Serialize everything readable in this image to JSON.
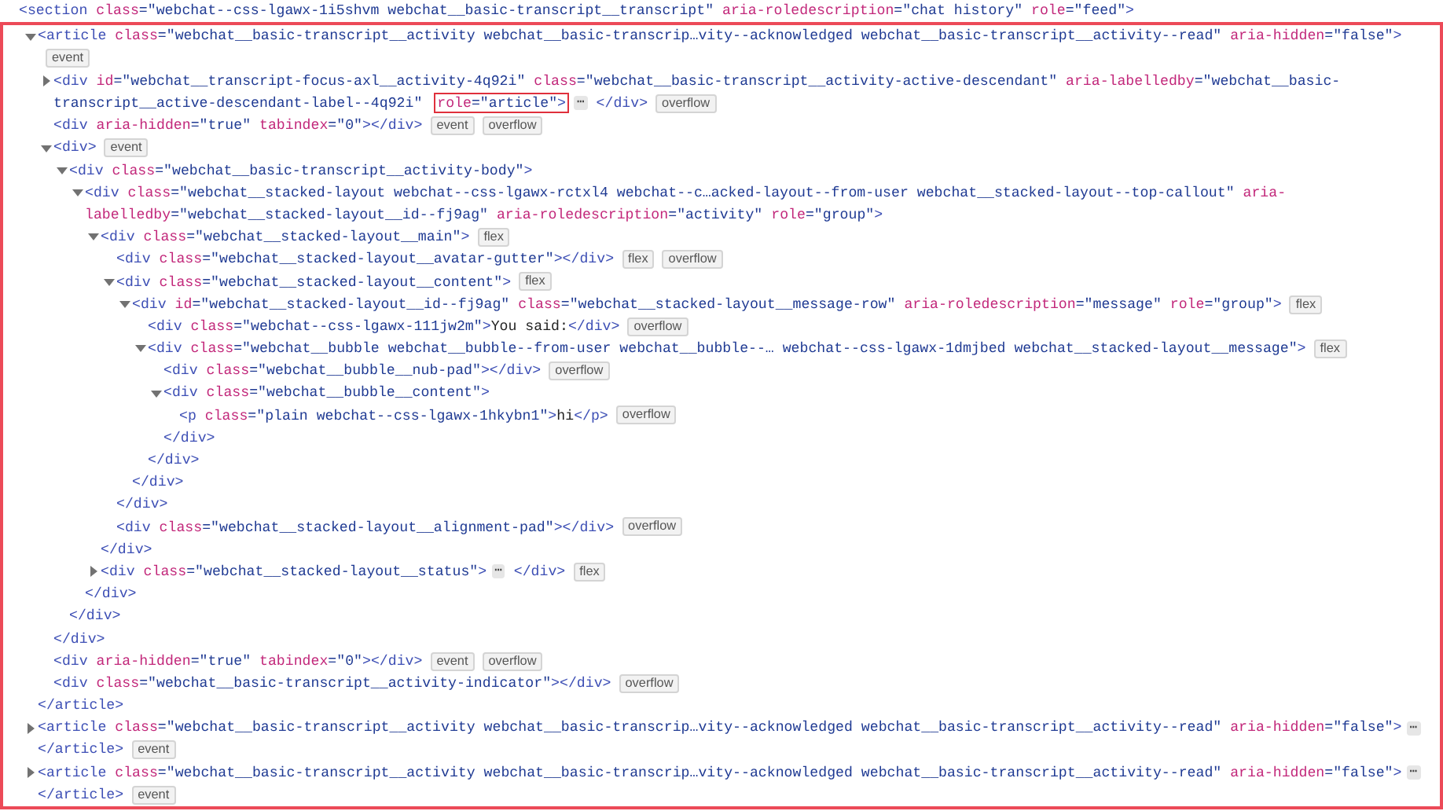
{
  "dom_tree": [
    {
      "lines": [
        [
          {
            "kind": "tag",
            "text": "<section "
          },
          {
            "kind": "attr",
            "text": "class"
          },
          {
            "kind": "val",
            "text": "=\"webchat--css-lgawx-1i5shvm webchat__basic-transcript__transcript\" "
          },
          {
            "kind": "attr",
            "text": "aria-roledescription"
          },
          {
            "kind": "val",
            "text": "=\"chat history\" "
          },
          {
            "kind": "attr",
            "text": "role"
          },
          {
            "kind": "val",
            "text": "=\"feed\""
          },
          {
            "kind": "tag",
            "text": ">"
          }
        ]
      ],
      "children": [
        {
          "expanded": true,
          "lines": [
            [
              {
                "kind": "tag",
                "text": "<article "
              },
              {
                "kind": "attr",
                "text": "class"
              },
              {
                "kind": "val",
                "text": "=\"webchat__basic-transcript__activity webchat__basic-transcrip…vity--acknowledged webchat__basic-transcript__activity--read\" "
              },
              {
                "kind": "attr",
                "text": "aria-hidden"
              },
              {
                "kind": "val",
                "text": "=\"false\""
              },
              {
                "kind": "tag",
                "text": ">"
              }
            ],
            [
              {
                "kind": "badge",
                "text": "event"
              }
            ]
          ],
          "close": [
            [
              {
                "kind": "tag",
                "text": "</article>"
              }
            ]
          ],
          "children": [
            {
              "expanded": false,
              "lines": [
                [
                  {
                    "kind": "tag",
                    "text": "<div "
                  },
                  {
                    "kind": "attr",
                    "text": "id"
                  },
                  {
                    "kind": "val",
                    "text": "=\"webchat__transcript-focus-axl__activity-4q92i\" "
                  },
                  {
                    "kind": "attr",
                    "text": "class"
                  },
                  {
                    "kind": "val",
                    "text": "=\"webchat__basic-transcript__activity-active-descendant\" "
                  },
                  {
                    "kind": "attr",
                    "text": "aria-labelledby"
                  },
                  {
                    "kind": "val",
                    "text": "=\"webchat__basic-"
                  }
                ],
                [
                  {
                    "kind": "val",
                    "text": "transcript__active-descendant-label--4q92i\" "
                  },
                  {
                    "kind": "highlight",
                    "parts": [
                      {
                        "kind": "attr",
                        "text": "role"
                      },
                      {
                        "kind": "val",
                        "text": "=\"article\""
                      },
                      {
                        "kind": "tag",
                        "text": ">"
                      }
                    ]
                  },
                  {
                    "kind": "more",
                    "text": "⋯"
                  },
                  {
                    "kind": "tag",
                    "text": " </div>"
                  },
                  {
                    "kind": "badge",
                    "text": "overflow"
                  }
                ]
              ]
            },
            {
              "lines": [
                [
                  {
                    "kind": "tag",
                    "text": "<div "
                  },
                  {
                    "kind": "attr",
                    "text": "aria-hidden"
                  },
                  {
                    "kind": "val",
                    "text": "=\"true\" "
                  },
                  {
                    "kind": "attr",
                    "text": "tabindex"
                  },
                  {
                    "kind": "val",
                    "text": "=\"0\""
                  },
                  {
                    "kind": "tag",
                    "text": "></div>"
                  },
                  {
                    "kind": "badge",
                    "text": "event"
                  },
                  {
                    "kind": "badge",
                    "text": "overflow"
                  }
                ]
              ]
            },
            {
              "expanded": true,
              "lines": [
                [
                  {
                    "kind": "tag",
                    "text": "<div>"
                  },
                  {
                    "kind": "badge",
                    "text": "event"
                  }
                ]
              ],
              "close": [
                [
                  {
                    "kind": "tag",
                    "text": "</div>"
                  }
                ]
              ],
              "children": [
                {
                  "expanded": true,
                  "lines": [
                    [
                      {
                        "kind": "tag",
                        "text": "<div "
                      },
                      {
                        "kind": "attr",
                        "text": "class"
                      },
                      {
                        "kind": "val",
                        "text": "=\"webchat__basic-transcript__activity-body\""
                      },
                      {
                        "kind": "tag",
                        "text": ">"
                      }
                    ]
                  ],
                  "close": [
                    [
                      {
                        "kind": "tag",
                        "text": "</div>"
                      }
                    ]
                  ],
                  "children": [
                    {
                      "expanded": true,
                      "lines": [
                        [
                          {
                            "kind": "tag",
                            "text": "<div "
                          },
                          {
                            "kind": "attr",
                            "text": "class"
                          },
                          {
                            "kind": "val",
                            "text": "=\"webchat__stacked-layout webchat--css-lgawx-rctxl4 webchat--c…acked-layout--from-user webchat__stacked-layout--top-callout\" "
                          },
                          {
                            "kind": "attr",
                            "text": "aria-"
                          }
                        ],
                        [
                          {
                            "kind": "attr",
                            "text": "labelledby"
                          },
                          {
                            "kind": "val",
                            "text": "=\"webchat__stacked-layout__id--fj9ag\" "
                          },
                          {
                            "kind": "attr",
                            "text": "aria-roledescription"
                          },
                          {
                            "kind": "val",
                            "text": "=\"activity\" "
                          },
                          {
                            "kind": "attr",
                            "text": "role"
                          },
                          {
                            "kind": "val",
                            "text": "=\"group\""
                          },
                          {
                            "kind": "tag",
                            "text": ">"
                          }
                        ]
                      ],
                      "close": [
                        [
                          {
                            "kind": "tag",
                            "text": "</div>"
                          }
                        ]
                      ],
                      "children": [
                        {
                          "expanded": true,
                          "lines": [
                            [
                              {
                                "kind": "tag",
                                "text": "<div "
                              },
                              {
                                "kind": "attr",
                                "text": "class"
                              },
                              {
                                "kind": "val",
                                "text": "=\"webchat__stacked-layout__main\""
                              },
                              {
                                "kind": "tag",
                                "text": ">"
                              },
                              {
                                "kind": "badge",
                                "text": "flex"
                              }
                            ]
                          ],
                          "close": [
                            [
                              {
                                "kind": "tag",
                                "text": "</div>"
                              }
                            ]
                          ],
                          "children": [
                            {
                              "lines": [
                                [
                                  {
                                    "kind": "tag",
                                    "text": "<div "
                                  },
                                  {
                                    "kind": "attr",
                                    "text": "class"
                                  },
                                  {
                                    "kind": "val",
                                    "text": "=\"webchat__stacked-layout__avatar-gutter\""
                                  },
                                  {
                                    "kind": "tag",
                                    "text": "></div>"
                                  },
                                  {
                                    "kind": "badge",
                                    "text": "flex"
                                  },
                                  {
                                    "kind": "badge",
                                    "text": "overflow"
                                  }
                                ]
                              ]
                            },
                            {
                              "expanded": true,
                              "lines": [
                                [
                                  {
                                    "kind": "tag",
                                    "text": "<div "
                                  },
                                  {
                                    "kind": "attr",
                                    "text": "class"
                                  },
                                  {
                                    "kind": "val",
                                    "text": "=\"webchat__stacked-layout__content\""
                                  },
                                  {
                                    "kind": "tag",
                                    "text": ">"
                                  },
                                  {
                                    "kind": "badge",
                                    "text": "flex"
                                  }
                                ]
                              ],
                              "close": [
                                [
                                  {
                                    "kind": "tag",
                                    "text": "</div>"
                                  }
                                ]
                              ],
                              "children": [
                                {
                                  "expanded": true,
                                  "lines": [
                                    [
                                      {
                                        "kind": "tag",
                                        "text": "<div "
                                      },
                                      {
                                        "kind": "attr",
                                        "text": "id"
                                      },
                                      {
                                        "kind": "val",
                                        "text": "=\"webchat__stacked-layout__id--fj9ag\" "
                                      },
                                      {
                                        "kind": "attr",
                                        "text": "class"
                                      },
                                      {
                                        "kind": "val",
                                        "text": "=\"webchat__stacked-layout__message-row\" "
                                      },
                                      {
                                        "kind": "attr",
                                        "text": "aria-roledescription"
                                      },
                                      {
                                        "kind": "val",
                                        "text": "=\"message\" "
                                      },
                                      {
                                        "kind": "attr",
                                        "text": "role"
                                      },
                                      {
                                        "kind": "val",
                                        "text": "=\"group\""
                                      },
                                      {
                                        "kind": "tag",
                                        "text": ">"
                                      },
                                      {
                                        "kind": "badge",
                                        "text": "flex"
                                      }
                                    ]
                                  ],
                                  "close": [
                                    [
                                      {
                                        "kind": "tag",
                                        "text": "</div>"
                                      }
                                    ]
                                  ],
                                  "children": [
                                    {
                                      "lines": [
                                        [
                                          {
                                            "kind": "tag",
                                            "text": "<div "
                                          },
                                          {
                                            "kind": "attr",
                                            "text": "class"
                                          },
                                          {
                                            "kind": "val",
                                            "text": "=\"webchat--css-lgawx-111jw2m\""
                                          },
                                          {
                                            "kind": "tag",
                                            "text": ">"
                                          },
                                          {
                                            "kind": "text",
                                            "text": "You said:"
                                          },
                                          {
                                            "kind": "tag",
                                            "text": "</div>"
                                          },
                                          {
                                            "kind": "badge",
                                            "text": "overflow"
                                          }
                                        ]
                                      ]
                                    },
                                    {
                                      "expanded": true,
                                      "lines": [
                                        [
                                          {
                                            "kind": "tag",
                                            "text": "<div "
                                          },
                                          {
                                            "kind": "attr",
                                            "text": "class"
                                          },
                                          {
                                            "kind": "val",
                                            "text": "=\"webchat__bubble webchat__bubble--from-user webchat__bubble--… webchat--css-lgawx-1dmjbed webchat__stacked-layout__message\""
                                          },
                                          {
                                            "kind": "tag",
                                            "text": ">"
                                          },
                                          {
                                            "kind": "badge",
                                            "text": "flex"
                                          }
                                        ]
                                      ],
                                      "close": [
                                        [
                                          {
                                            "kind": "tag",
                                            "text": "</div>"
                                          }
                                        ]
                                      ],
                                      "children": [
                                        {
                                          "lines": [
                                            [
                                              {
                                                "kind": "tag",
                                                "text": "<div "
                                              },
                                              {
                                                "kind": "attr",
                                                "text": "class"
                                              },
                                              {
                                                "kind": "val",
                                                "text": "=\"webchat__bubble__nub-pad\""
                                              },
                                              {
                                                "kind": "tag",
                                                "text": "></div>"
                                              },
                                              {
                                                "kind": "badge",
                                                "text": "overflow"
                                              }
                                            ]
                                          ]
                                        },
                                        {
                                          "expanded": true,
                                          "lines": [
                                            [
                                              {
                                                "kind": "tag",
                                                "text": "<div "
                                              },
                                              {
                                                "kind": "attr",
                                                "text": "class"
                                              },
                                              {
                                                "kind": "val",
                                                "text": "=\"webchat__bubble__content\""
                                              },
                                              {
                                                "kind": "tag",
                                                "text": ">"
                                              }
                                            ]
                                          ],
                                          "close": [
                                            [
                                              {
                                                "kind": "tag",
                                                "text": "</div>"
                                              }
                                            ]
                                          ],
                                          "children": [
                                            {
                                              "lines": [
                                                [
                                                  {
                                                    "kind": "tag",
                                                    "text": "<p "
                                                  },
                                                  {
                                                    "kind": "attr",
                                                    "text": "class"
                                                  },
                                                  {
                                                    "kind": "val",
                                                    "text": "=\"plain webchat--css-lgawx-1hkybn1\""
                                                  },
                                                  {
                                                    "kind": "tag",
                                                    "text": ">"
                                                  },
                                                  {
                                                    "kind": "text",
                                                    "text": "hi"
                                                  },
                                                  {
                                                    "kind": "tag",
                                                    "text": "</p>"
                                                  },
                                                  {
                                                    "kind": "badge",
                                                    "text": "overflow"
                                                  }
                                                ]
                                              ]
                                            }
                                          ]
                                        }
                                      ]
                                    }
                                  ]
                                }
                              ]
                            },
                            {
                              "lines": [
                                [
                                  {
                                    "kind": "tag",
                                    "text": "<div "
                                  },
                                  {
                                    "kind": "attr",
                                    "text": "class"
                                  },
                                  {
                                    "kind": "val",
                                    "text": "=\"webchat__stacked-layout__alignment-pad\""
                                  },
                                  {
                                    "kind": "tag",
                                    "text": "></div>"
                                  },
                                  {
                                    "kind": "badge",
                                    "text": "overflow"
                                  }
                                ]
                              ]
                            }
                          ]
                        },
                        {
                          "expanded": false,
                          "lines": [
                            [
                              {
                                "kind": "tag",
                                "text": "<div "
                              },
                              {
                                "kind": "attr",
                                "text": "class"
                              },
                              {
                                "kind": "val",
                                "text": "=\"webchat__stacked-layout__status\""
                              },
                              {
                                "kind": "tag",
                                "text": ">"
                              },
                              {
                                "kind": "more",
                                "text": "⋯"
                              },
                              {
                                "kind": "tag",
                                "text": " </div>"
                              },
                              {
                                "kind": "badge",
                                "text": "flex"
                              }
                            ]
                          ]
                        }
                      ]
                    }
                  ]
                }
              ]
            },
            {
              "lines": [
                [
                  {
                    "kind": "tag",
                    "text": "<div "
                  },
                  {
                    "kind": "attr",
                    "text": "aria-hidden"
                  },
                  {
                    "kind": "val",
                    "text": "=\"true\" "
                  },
                  {
                    "kind": "attr",
                    "text": "tabindex"
                  },
                  {
                    "kind": "val",
                    "text": "=\"0\""
                  },
                  {
                    "kind": "tag",
                    "text": "></div>"
                  },
                  {
                    "kind": "badge",
                    "text": "event"
                  },
                  {
                    "kind": "badge",
                    "text": "overflow"
                  }
                ]
              ]
            },
            {
              "lines": [
                [
                  {
                    "kind": "tag",
                    "text": "<div "
                  },
                  {
                    "kind": "attr",
                    "text": "class"
                  },
                  {
                    "kind": "val",
                    "text": "=\"webchat__basic-transcript__activity-indicator\""
                  },
                  {
                    "kind": "tag",
                    "text": "></div>"
                  },
                  {
                    "kind": "badge",
                    "text": "overflow"
                  }
                ]
              ]
            }
          ]
        },
        {
          "expanded": false,
          "lines": [
            [
              {
                "kind": "tag",
                "text": "<article "
              },
              {
                "kind": "attr",
                "text": "class"
              },
              {
                "kind": "val",
                "text": "=\"webchat__basic-transcript__activity webchat__basic-transcrip…vity--acknowledged webchat__basic-transcript__activity--read\" "
              },
              {
                "kind": "attr",
                "text": "aria-hidden"
              },
              {
                "kind": "val",
                "text": "=\"false\""
              },
              {
                "kind": "tag",
                "text": ">"
              },
              {
                "kind": "more",
                "text": "⋯"
              }
            ]
          ],
          "close": [
            [
              {
                "kind": "tag",
                "text": "</article>"
              },
              {
                "kind": "badge",
                "text": "event"
              }
            ]
          ]
        },
        {
          "expanded": false,
          "lines": [
            [
              {
                "kind": "tag",
                "text": "<article "
              },
              {
                "kind": "attr",
                "text": "class"
              },
              {
                "kind": "val",
                "text": "=\"webchat__basic-transcript__activity webchat__basic-transcrip…vity--acknowledged webchat__basic-transcript__activity--read\" "
              },
              {
                "kind": "attr",
                "text": "aria-hidden"
              },
              {
                "kind": "val",
                "text": "=\"false\""
              },
              {
                "kind": "tag",
                "text": ">"
              },
              {
                "kind": "more",
                "text": "⋯"
              }
            ]
          ],
          "close": [
            [
              {
                "kind": "tag",
                "text": "</article>"
              },
              {
                "kind": "badge",
                "text": "event"
              }
            ]
          ]
        }
      ]
    }
  ]
}
